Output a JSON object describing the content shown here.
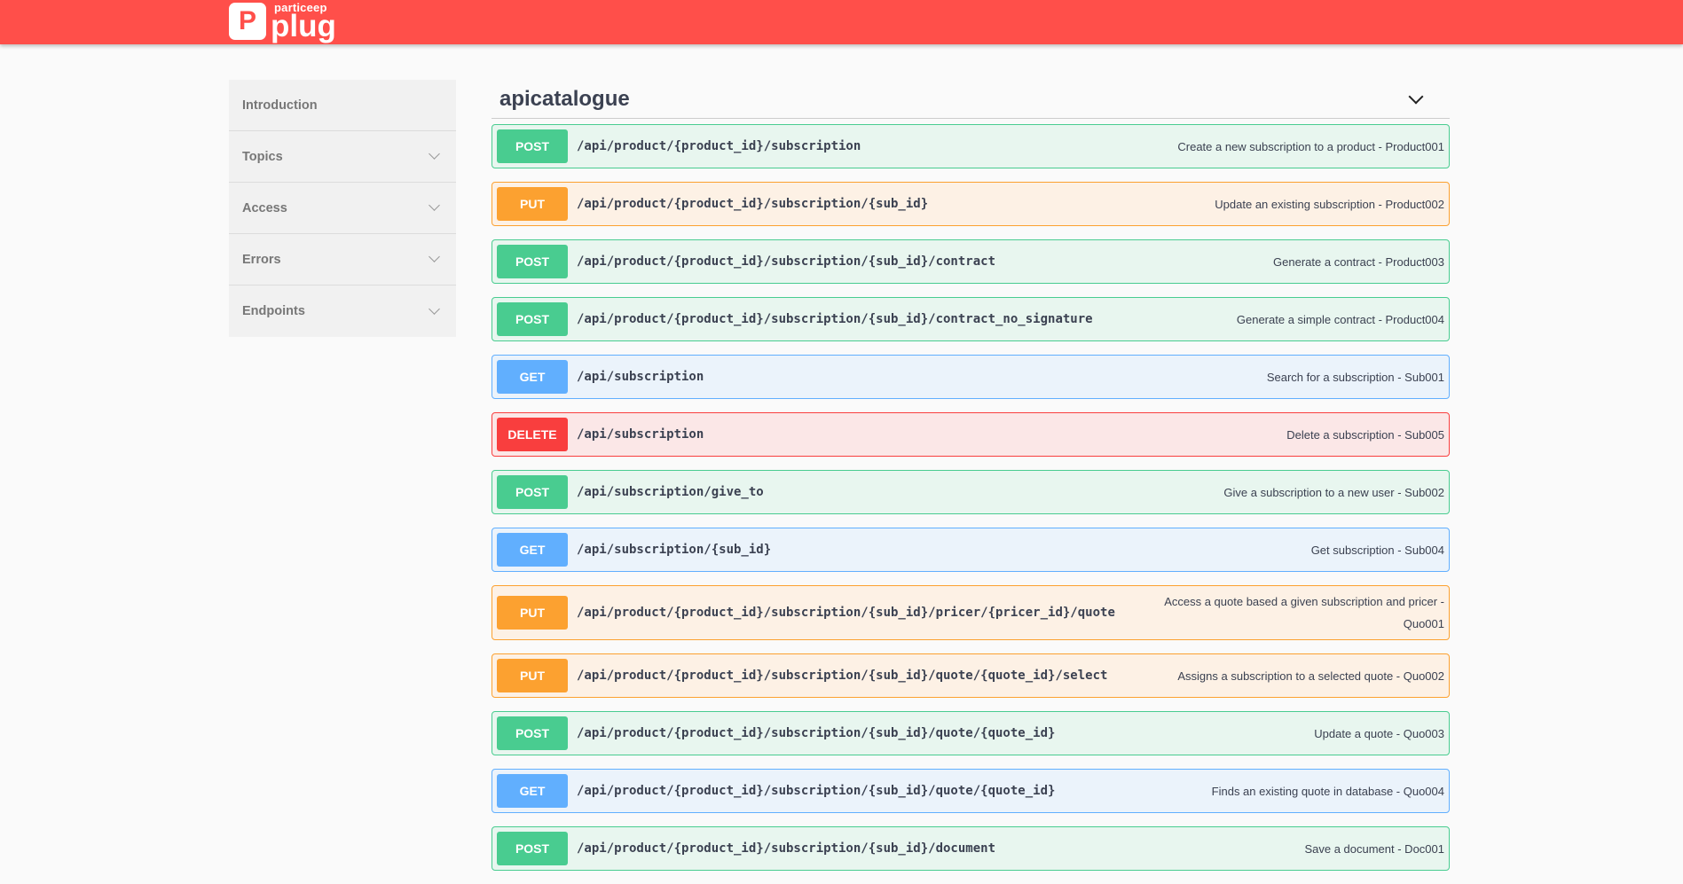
{
  "header": {
    "logo_small": "particeep",
    "logo_big": "plug"
  },
  "sidebar": {
    "items": [
      {
        "label": "Introduction",
        "expandable": false
      },
      {
        "label": "Topics",
        "expandable": true
      },
      {
        "label": "Access",
        "expandable": true
      },
      {
        "label": "Errors",
        "expandable": true
      },
      {
        "label": "Endpoints",
        "expandable": true
      }
    ]
  },
  "section": {
    "title": "apicatalogue"
  },
  "operations": [
    {
      "method": "POST",
      "path": "/api/product/{product_id}/subscription",
      "summary": "Create a new subscription to a product - Product001"
    },
    {
      "method": "PUT",
      "path": "/api/product/{product_id}/subscription/{sub_id}",
      "summary": "Update an existing subscription - Product002"
    },
    {
      "method": "POST",
      "path": "/api/product/{product_id}/subscription/{sub_id}/contract",
      "summary": "Generate a contract - Product003"
    },
    {
      "method": "POST",
      "path": "/api/product/{product_id}/subscription/{sub_id}/contract_no_signature",
      "summary": "Generate a simple contract - Product004"
    },
    {
      "method": "GET",
      "path": "/api/subscription",
      "summary": "Search for a subscription - Sub001"
    },
    {
      "method": "DELETE",
      "path": "/api/subscription",
      "summary": "Delete a subscription - Sub005"
    },
    {
      "method": "POST",
      "path": "/api/subscription/give_to",
      "summary": "Give a subscription to a new user - Sub002"
    },
    {
      "method": "GET",
      "path": "/api/subscription/{sub_id}",
      "summary": "Get subscription - Sub004"
    },
    {
      "method": "PUT",
      "path": "/api/product/{product_id}/subscription/{sub_id}/pricer/{pricer_id}/quote",
      "summary": "Access a quote based a given subscription and pricer - Quo001"
    },
    {
      "method": "PUT",
      "path": "/api/product/{product_id}/subscription/{sub_id}/quote/{quote_id}/select",
      "summary": "Assigns a subscription to a selected quote - Quo002"
    },
    {
      "method": "POST",
      "path": "/api/product/{product_id}/subscription/{sub_id}/quote/{quote_id}",
      "summary": "Update a quote - Quo003"
    },
    {
      "method": "GET",
      "path": "/api/product/{product_id}/subscription/{sub_id}/quote/{quote_id}",
      "summary": "Finds an existing quote in database - Quo004"
    },
    {
      "method": "POST",
      "path": "/api/product/{product_id}/subscription/{sub_id}/document",
      "summary": "Save a document - Doc001"
    }
  ],
  "colors": {
    "header": "#ff4f4a",
    "post": "#49cc90",
    "put": "#fca130",
    "get": "#61affe",
    "delete": "#f93e3e"
  }
}
